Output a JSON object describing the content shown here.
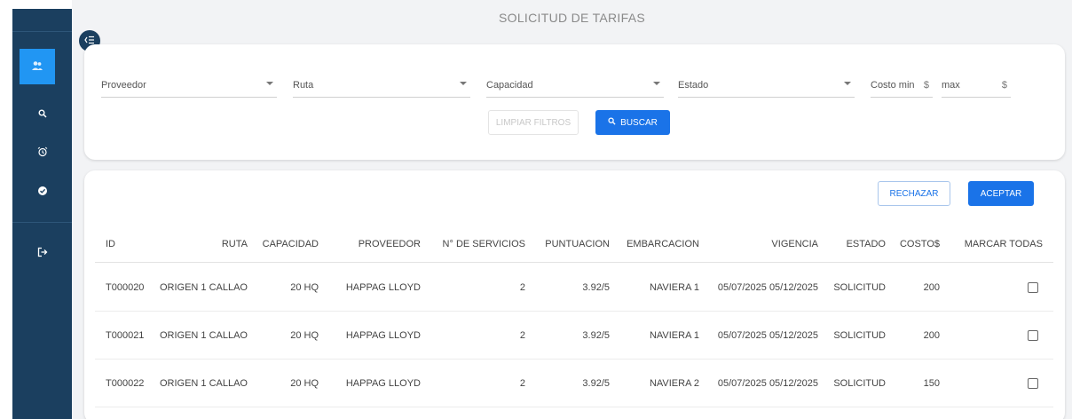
{
  "page": {
    "title": "SOLICITUD DE TARIFAS"
  },
  "sidebar": {
    "items": [
      {
        "name": "users",
        "icon": "users-icon",
        "active": true
      },
      {
        "name": "search",
        "icon": "search-icon"
      },
      {
        "name": "alarm",
        "icon": "alarm-icon"
      },
      {
        "name": "check",
        "icon": "check-circle-icon"
      },
      {
        "name": "logout",
        "icon": "logout-icon"
      }
    ]
  },
  "filters": {
    "proveedor": "Proveedor",
    "ruta": "Ruta",
    "capacidad": "Capacidad",
    "estado": "Estado",
    "costo_min": "Costo min",
    "max": "max",
    "currency": "$",
    "clear_label": "LIMPIAR FILTROS",
    "search_label": "BUSCAR"
  },
  "actions": {
    "reject_label": "RECHAZAR",
    "accept_label": "ACEPTAR"
  },
  "table": {
    "headers": [
      "ID",
      "RUTA",
      "CAPACIDAD",
      "PROVEEDOR",
      "N° DE SERVICIOS",
      "PUNTUACION",
      "EMBARCACION",
      "VIGENCIA",
      "ESTADO",
      "COSTO$",
      "MARCAR TODAS"
    ],
    "rows": [
      {
        "id": "T000020",
        "ruta": "ORIGEN 1 CALLAO",
        "capacidad": "20 HQ",
        "proveedor": "HAPPAG LLOYD",
        "servicios": "2",
        "puntuacion": "3.92/5",
        "embarcacion": "NAVIERA 1",
        "vigencia": "05/07/2025 05/12/2025",
        "estado": "SOLICITUD",
        "costo": "200"
      },
      {
        "id": "T000021",
        "ruta": "ORIGEN 1 CALLAO",
        "capacidad": "20 HQ",
        "proveedor": "HAPPAG LLOYD",
        "servicios": "2",
        "puntuacion": "3.92/5",
        "embarcacion": "NAVIERA 1",
        "vigencia": "05/07/2025 05/12/2025",
        "estado": "SOLICITUD",
        "costo": "200"
      },
      {
        "id": "T000022",
        "ruta": "ORIGEN 1 CALLAO",
        "capacidad": "20 HQ",
        "proveedor": "HAPPAG LLOYD",
        "servicios": "2",
        "puntuacion": "3.92/5",
        "embarcacion": "NAVIERA 2",
        "vigencia": "05/07/2025 05/12/2025",
        "estado": "SOLICITUD",
        "costo": "150"
      }
    ]
  },
  "colors": {
    "sidebar": "#1b3f5f",
    "primary": "#1a73e8",
    "active_item": "#2196f3"
  }
}
